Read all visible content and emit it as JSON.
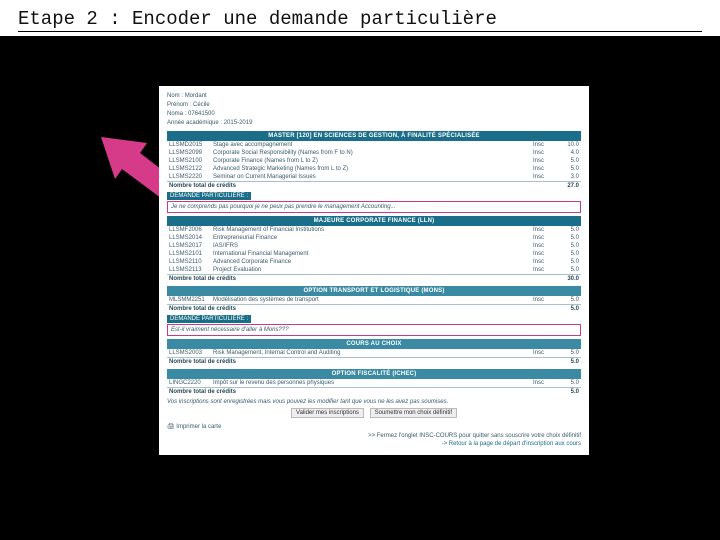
{
  "title": "Etape 2 : Encoder une demande particulière",
  "student": {
    "nom_label": "Nom :",
    "nom": "Mordant",
    "prenom_label": "Prénom :",
    "prenom": "Cécile",
    "noma_label": "Noma :",
    "noma": "07641500",
    "annee_label": "Année académique :",
    "annee": "2015-2019"
  },
  "sections": [
    {
      "band": "MASTER [120] EN SCIENCES DE GESTION, À FINALITÉ SPÉCIALISÉE",
      "rows": [
        {
          "code": "LLSMD2015",
          "name": "Stage avec accompagnement",
          "status": "Insc",
          "val": "10.0"
        },
        {
          "code": "LLSMS2099",
          "name": "Corporate Social Responsibility (Names from F to N)",
          "status": "Insc",
          "val": "4.0"
        },
        {
          "code": "LLSMS2100",
          "name": "Corporate Finance (Names from L to Z)",
          "status": "Insc",
          "val": "5.0"
        },
        {
          "code": "LLSMS2122",
          "name": "Advanced Strategic Marketing (Names from L to Z)",
          "status": "Insc",
          "val": "5.0"
        },
        {
          "code": "LLSMS2220",
          "name": "Seminar on Current Managerial Issues",
          "status": "Insc",
          "val": "3.0"
        }
      ],
      "total_label": "Nombre total de crédits",
      "total": "27.0",
      "demande_label": "DEMANDE PARTICULIÈRE :",
      "demande_text": "Je ne comprends pas pourquoi je ne peux pas prendre le management Accounting..."
    },
    {
      "band": "MAJEURE CORPORATE FINANCE (LLN)",
      "rows": [
        {
          "code": "LLSMF2006",
          "name": "Risk Management of Financial Institutions",
          "status": "Insc",
          "val": "5.0"
        },
        {
          "code": "LLSMS2014",
          "name": "Entrepreneurial Finance",
          "status": "Insc",
          "val": "5.0"
        },
        {
          "code": "LLSMS2017",
          "name": "IAS/IFRS",
          "status": "Insc",
          "val": "5.0"
        },
        {
          "code": "LLSMS2101",
          "name": "International Financial Management",
          "status": "Insc",
          "val": "5.0"
        },
        {
          "code": "LLSMS2110",
          "name": "Advanced Corporate Finance",
          "status": "Insc",
          "val": "5.0"
        },
        {
          "code": "LLSMS2113",
          "name": "Project Evaluation",
          "status": "Insc",
          "val": "5.0"
        }
      ],
      "total_label": "Nombre total de crédits",
      "total": "30.0"
    },
    {
      "band": "OPTION TRANSPORT ET LOGISTIQUE (MONS)",
      "band_light": true,
      "rows": [
        {
          "code": "MLSMM2251",
          "name": "Modélisation des systèmes de transport",
          "status": "Insc",
          "val": "5.0"
        }
      ],
      "total_label": "Nombre total de crédits",
      "total": "5.0",
      "demande_label": "DEMANDE PARTICULIÈRE :",
      "demande_text": "Est-il vraiment nécessaire d'aller à Mons???"
    },
    {
      "band": "COURS AU CHOIX",
      "band_light": true,
      "rows": [
        {
          "code": "LLSMS2003",
          "name": "Risk Management, Internal Control and Auditing",
          "status": "Insc",
          "val": "5.0"
        }
      ],
      "total_label": "Nombre total de crédits",
      "total": "5.0"
    },
    {
      "band": "OPTION FISCALITÉ (ICHEC)",
      "band_light": true,
      "rows": [
        {
          "code": "LINGC2220",
          "name": "Impôt sur le revenu des personnes physiques",
          "status": "Insc",
          "val": "5.0"
        }
      ],
      "total_label": "Nombre total de crédits",
      "total": "5.0"
    }
  ],
  "footer_note": "Vos inscriptions sont enregistrées mais vous pouvez les modifier tant que vous ne les avez pas soumises.",
  "btn_validate": "Valider mes inscriptions",
  "btn_submit": "Soumettre mon choix définitif",
  "print_label": "Imprimer la carte",
  "close_note": ">> Fermez l'onglet INSC-COURS pour quitter sans souscrire votre choix définitif",
  "return_link": "-> Retour à la page de départ d'inscription aux cours"
}
